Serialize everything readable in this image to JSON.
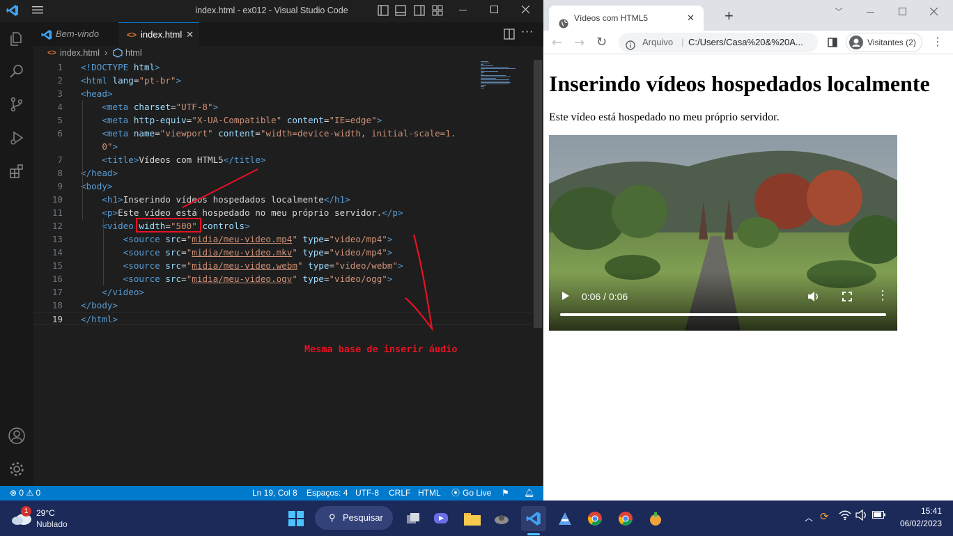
{
  "vscode": {
    "window_title": "index.html - ex012 - Visual Studio Code",
    "tabs": [
      {
        "label": "Bem-vindo"
      },
      {
        "label": "index.html"
      }
    ],
    "breadcrumb": {
      "file": "index.html",
      "symbol": "html"
    },
    "code_lines": [
      {
        "n": "1",
        "tokens": [
          [
            "tg",
            "<!DOCTYPE "
          ],
          [
            "at",
            "html"
          ],
          [
            "tg",
            ">"
          ]
        ]
      },
      {
        "n": "2",
        "tokens": [
          [
            "tg",
            "<html "
          ],
          [
            "at",
            "lang"
          ],
          [
            "tx",
            "="
          ],
          [
            "st",
            "\"pt-br\""
          ],
          [
            "tg",
            ">"
          ]
        ]
      },
      {
        "n": "3",
        "tokens": [
          [
            "tg",
            "<head>"
          ]
        ]
      },
      {
        "n": "4",
        "tokens": [
          [
            "tx",
            "    "
          ],
          [
            "tg",
            "<meta "
          ],
          [
            "at",
            "charset"
          ],
          [
            "tx",
            "="
          ],
          [
            "st",
            "\"UTF-8\""
          ],
          [
            "tg",
            ">"
          ]
        ]
      },
      {
        "n": "5",
        "tokens": [
          [
            "tx",
            "    "
          ],
          [
            "tg",
            "<meta "
          ],
          [
            "at",
            "http-equiv"
          ],
          [
            "tx",
            "="
          ],
          [
            "st",
            "\"X-UA-Compatible\""
          ],
          [
            "tx",
            " "
          ],
          [
            "at",
            "content"
          ],
          [
            "tx",
            "="
          ],
          [
            "st",
            "\"IE=edge\""
          ],
          [
            "tg",
            ">"
          ]
        ]
      },
      {
        "n": "6",
        "tokens": [
          [
            "tx",
            "    "
          ],
          [
            "tg",
            "<meta "
          ],
          [
            "at",
            "name"
          ],
          [
            "tx",
            "="
          ],
          [
            "st",
            "\"viewport\""
          ],
          [
            "tx",
            " "
          ],
          [
            "at",
            "content"
          ],
          [
            "tx",
            "="
          ],
          [
            "st",
            "\"width=device-width, initial-scale=1."
          ]
        ]
      },
      {
        "n": "",
        "tokens": [
          [
            "tx",
            "    "
          ],
          [
            "st",
            "0\""
          ],
          [
            "tg",
            ">"
          ]
        ]
      },
      {
        "n": "7",
        "tokens": [
          [
            "tx",
            "    "
          ],
          [
            "tg",
            "<title>"
          ],
          [
            "tx",
            "Vídeos com HTML5"
          ],
          [
            "tg",
            "</title>"
          ]
        ]
      },
      {
        "n": "8",
        "tokens": [
          [
            "tg",
            "</head>"
          ]
        ]
      },
      {
        "n": "9",
        "tokens": [
          [
            "tg",
            "<body>"
          ]
        ]
      },
      {
        "n": "10",
        "tokens": [
          [
            "tx",
            "    "
          ],
          [
            "tg",
            "<h1>"
          ],
          [
            "tx",
            "Inserindo vídeos hospedados localmente"
          ],
          [
            "tg",
            "</h1>"
          ]
        ]
      },
      {
        "n": "11",
        "tokens": [
          [
            "tx",
            "    "
          ],
          [
            "tg",
            "<p>"
          ],
          [
            "tx",
            "Este vídeo está hospedado no meu próprio servidor."
          ],
          [
            "tg",
            "</p>"
          ]
        ]
      },
      {
        "n": "12",
        "tokens": [
          [
            "tx",
            "    "
          ],
          [
            "tg",
            "<video "
          ],
          [
            "at",
            "width"
          ],
          [
            "tx",
            "="
          ],
          [
            "st",
            "\"500\""
          ],
          [
            "tx",
            " "
          ],
          [
            "at",
            "controls"
          ],
          [
            "tg",
            ">"
          ]
        ]
      },
      {
        "n": "13",
        "tokens": [
          [
            "tx",
            "        "
          ],
          [
            "tg",
            "<source "
          ],
          [
            "at",
            "src"
          ],
          [
            "tx",
            "="
          ],
          [
            "st",
            "\""
          ],
          [
            "ul",
            "midia/meu-video.mp4"
          ],
          [
            "st",
            "\""
          ],
          [
            "tx",
            " "
          ],
          [
            "at",
            "type"
          ],
          [
            "tx",
            "="
          ],
          [
            "st",
            "\"video/mp4\""
          ],
          [
            "tg",
            ">"
          ]
        ]
      },
      {
        "n": "14",
        "tokens": [
          [
            "tx",
            "        "
          ],
          [
            "tg",
            "<source "
          ],
          [
            "at",
            "src"
          ],
          [
            "tx",
            "="
          ],
          [
            "st",
            "\""
          ],
          [
            "ul",
            "midia/meu-video.mkv"
          ],
          [
            "st",
            "\""
          ],
          [
            "tx",
            " "
          ],
          [
            "at",
            "type"
          ],
          [
            "tx",
            "="
          ],
          [
            "st",
            "\"video/mp4\""
          ],
          [
            "tg",
            ">"
          ]
        ]
      },
      {
        "n": "15",
        "tokens": [
          [
            "tx",
            "        "
          ],
          [
            "tg",
            "<source "
          ],
          [
            "at",
            "src"
          ],
          [
            "tx",
            "="
          ],
          [
            "st",
            "\""
          ],
          [
            "ul",
            "midia/meu-video.webm"
          ],
          [
            "st",
            "\""
          ],
          [
            "tx",
            " "
          ],
          [
            "at",
            "type"
          ],
          [
            "tx",
            "="
          ],
          [
            "st",
            "\"video/webm\""
          ],
          [
            "tg",
            ">"
          ]
        ]
      },
      {
        "n": "16",
        "tokens": [
          [
            "tx",
            "        "
          ],
          [
            "tg",
            "<source "
          ],
          [
            "at",
            "src"
          ],
          [
            "tx",
            "="
          ],
          [
            "st",
            "\""
          ],
          [
            "ul",
            "midia/meu-video.ogv"
          ],
          [
            "st",
            "\""
          ],
          [
            "tx",
            " "
          ],
          [
            "at",
            "type"
          ],
          [
            "tx",
            "="
          ],
          [
            "st",
            "\"video/ogg\""
          ],
          [
            "tg",
            ">"
          ]
        ]
      },
      {
        "n": "17",
        "tokens": [
          [
            "tx",
            "    "
          ],
          [
            "tg",
            "</video>"
          ]
        ]
      },
      {
        "n": "18",
        "tokens": [
          [
            "tg",
            "</body>"
          ]
        ]
      },
      {
        "n": "19",
        "tokens": [
          [
            "tg",
            "</html>"
          ]
        ]
      }
    ],
    "annotation_text": "Mesma base de inserir áudio",
    "status": {
      "errors": "0",
      "warnings": "0",
      "position": "Ln 19, Col 8",
      "spaces": "Espaços: 4",
      "encoding": "UTF-8",
      "eol": "CRLF",
      "language": "HTML",
      "golive": "Go Live"
    },
    "colors": {
      "accent": "#007acc",
      "annotation": "#e81123"
    }
  },
  "chrome": {
    "tab_title": "Vídeos com HTML5",
    "address_label": "Arquivo",
    "address_url": "C:/Users/Casa%20&%20A...",
    "profile_label": "Visitantes (2)",
    "page_heading": "Inserindo vídeos hospedados localmente",
    "page_paragraph": "Este vídeo está hospedado no meu próprio servidor.",
    "video_time": "0:06 / 0:06",
    "video_progress": 1.0
  },
  "taskbar": {
    "weather_temp": "29°C",
    "weather_desc": "Nublado",
    "weather_badge": "1",
    "search_label": "Pesquisar",
    "time": "15:41",
    "date": "06/02/2023"
  }
}
